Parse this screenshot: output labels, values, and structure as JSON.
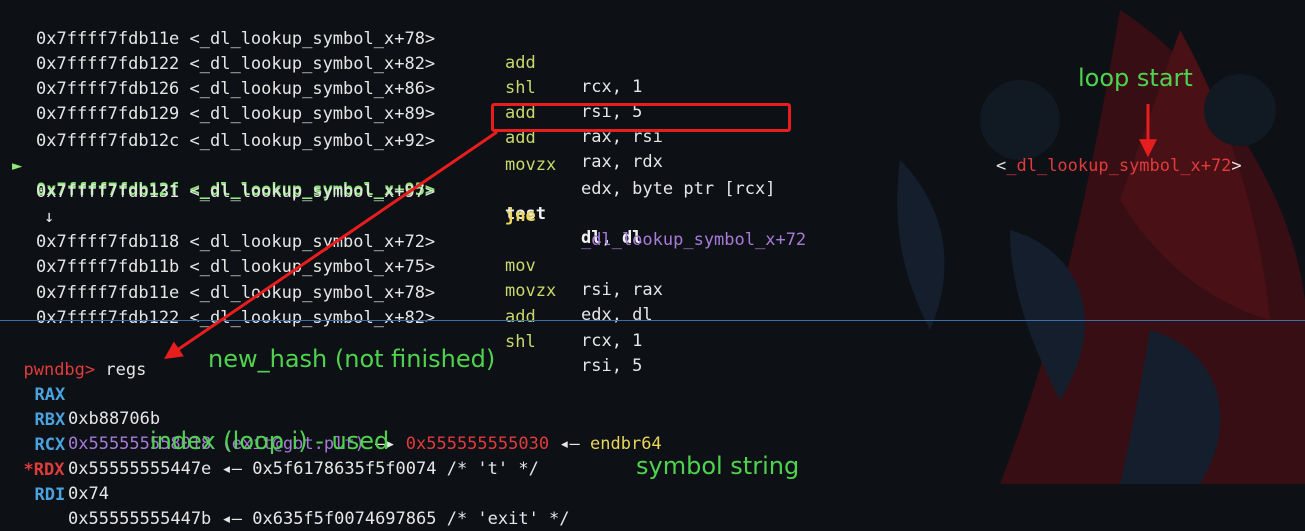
{
  "disasm": {
    "lines": [
      {
        "addr": "0x7ffff7fdb11e <_dl_lookup_symbol_x+78>",
        "mnemonic": "add",
        "operands": "rcx, 1"
      },
      {
        "addr": "0x7ffff7fdb122 <_dl_lookup_symbol_x+82>",
        "mnemonic": "shl",
        "operands": "rsi, 5"
      },
      {
        "addr": "0x7ffff7fdb126 <_dl_lookup_symbol_x+86>",
        "mnemonic": "add",
        "operands": "rax, rsi"
      },
      {
        "addr": "0x7ffff7fdb129 <_dl_lookup_symbol_x+89>",
        "mnemonic": "add",
        "operands": "rax, rdx"
      },
      {
        "addr": "0x7ffff7fdb12c <_dl_lookup_symbol_x+92>",
        "mnemonic": "movzx",
        "operands": "edx, byte ptr [rcx]"
      },
      {
        "addr": "0x7ffff7fdb12f <_dl_lookup_symbol_x+95>",
        "mnemonic": "test",
        "operands": "dl, dl"
      },
      {
        "addr": "0x7ffff7fdb131 <_dl_lookup_symbol_x+97>",
        "mnemonic": "jne",
        "operands": "_dl_lookup_symbol_x+72"
      },
      {
        "addr": "0x7ffff7fdb118 <_dl_lookup_symbol_x+72>",
        "mnemonic": "mov",
        "operands": "rsi, rax"
      },
      {
        "addr": "0x7ffff7fdb11b <_dl_lookup_symbol_x+75>",
        "mnemonic": "movzx",
        "operands": "edx, dl"
      },
      {
        "addr": "0x7ffff7fdb11e <_dl_lookup_symbol_x+78>",
        "mnemonic": "add",
        "operands": "rcx, 1"
      },
      {
        "addr": "0x7ffff7fdb122 <_dl_lookup_symbol_x+82>",
        "mnemonic": "shl",
        "operands": "rsi, 5"
      }
    ],
    "current_marker": "►",
    "jump_arrow": "↓",
    "jne_hint": {
      "pre": "<",
      "name": "_dl_lookup_symbol_x+72",
      "post": ">"
    }
  },
  "prompt": {
    "name": "pwndbg>",
    "command": " regs"
  },
  "registers": {
    "rax": {
      "name": "RAX",
      "value": "0xb88706b"
    },
    "rbx": {
      "name": "RBX",
      "value": "0x555555558018 (exit@got.plt)",
      "arrow1": " —▸ ",
      "ptr": "0x555555555030",
      "arrow2": " ◂— ",
      "insn": "endbr64"
    },
    "rcx": {
      "name": "RCX",
      "value": "0x55555555447e",
      "arrow": " ◂— ",
      "deref": "0x5f6178635f5f0074 /* 't' */"
    },
    "rdx": {
      "star": "*",
      "name": "RDX",
      "value": "0x74"
    },
    "rdi": {
      "name": "RDI",
      "value": "0x55555555447b",
      "arrow": " ◂— ",
      "deref": "0x635f5f0074697865 /* 'exit' */"
    }
  },
  "annotations": {
    "loop_start": "loop start",
    "new_hash": "new_hash (not finished)",
    "index": "index (loop i) - used",
    "symbol_string": "symbol string"
  },
  "colors": {
    "background": "#0d1015",
    "accent_red": "#e81d1d",
    "annotation_green": "#4fd34f",
    "current_line_green": "#8fe87a",
    "register_blue": "#4aa3df",
    "mnemonic_yellow": "#c8d86a"
  }
}
